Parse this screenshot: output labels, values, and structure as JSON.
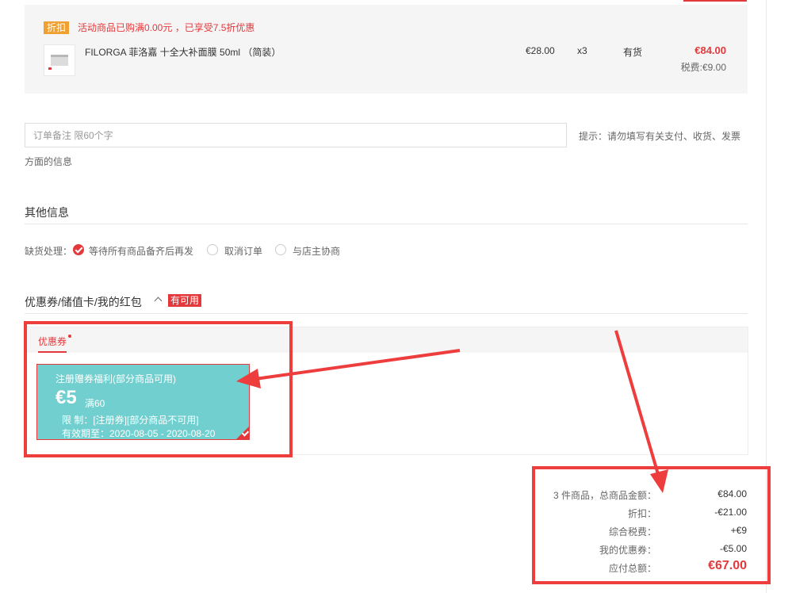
{
  "colors": {
    "accent": "#e4393c",
    "coupon_bg": "#72cfcf",
    "highlight": "#ee3d3d",
    "badge_orange": "#f0a030"
  },
  "product": {
    "promo_badge": "折扣",
    "promo_text": "活动商品已购满0.00元 ，已享受7.5折优惠",
    "name": "FILORGA 菲洛嘉 十全大补面膜 50ml （简装）",
    "unit_price": "€28.00",
    "quantity": "x3",
    "stock": "有货",
    "total": "€84.00",
    "tax": "税费:€9.00"
  },
  "remark": {
    "placeholder": "订单备注 限60个字",
    "hint_line1": "提示：请勿填写有关支付、收货、发票",
    "hint_line2": "方面的信息"
  },
  "other_info": {
    "title": "其他信息",
    "oos_label": "缺货处理：",
    "options": [
      {
        "label": "等待所有商品备齐后再发",
        "checked": true
      },
      {
        "label": "取消订单",
        "checked": false
      },
      {
        "label": "与店主协商",
        "checked": false
      }
    ]
  },
  "coupons": {
    "title": "优惠券/储值卡/我的红包",
    "chevron_icon": "chevron-up-icon",
    "available_badge": "有可用",
    "tab_label": "优惠券",
    "card": {
      "title": "注册赠券福利(部分商品可用)",
      "amount": "€5",
      "condition": "满60",
      "limit": "限 制：[注册券][部分商品不可用]",
      "validity": "有效期至：2020-08-05 - 2020-08-20",
      "selected": true
    }
  },
  "summary": {
    "rows": [
      {
        "label": "3 件商品，总商品金额：",
        "value": "€84.00"
      },
      {
        "label": "折扣：",
        "value": "-€21.00"
      },
      {
        "label": "综合税费：",
        "value": "+€9"
      },
      {
        "label": "我的优惠券：",
        "value": "-€5.00"
      }
    ],
    "total_label": "应付总额：",
    "total_value": "€67.00"
  }
}
